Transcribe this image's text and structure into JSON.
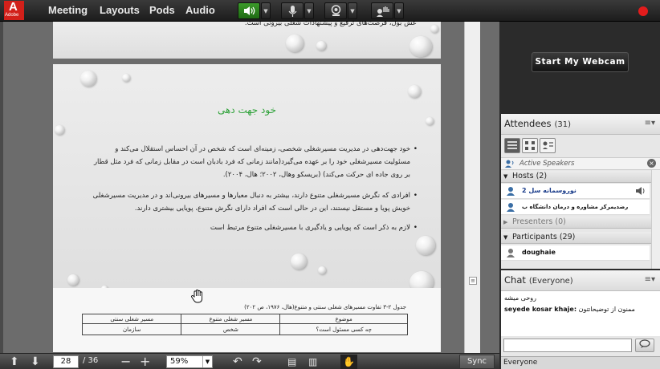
{
  "topbar": {
    "logo_text": "A",
    "logo_word": "Adobe",
    "menus": [
      "Meeting",
      "Layouts",
      "Pods",
      "Audio"
    ],
    "icons": [
      "speaker-icon",
      "microphone-icon",
      "webcam-icon",
      "raise-hand-icon"
    ],
    "speaker_color": "#2e8b22",
    "record_color": "#e21c1c"
  },
  "slides": {
    "prev_caption": "عش بول، فرصت‌های ترفیع و پیشنهادات شغلی بیرونی است.",
    "title": "خود جهت دهی",
    "title_color": "#2fa23a",
    "bullets": [
      "خود جهت‌دهی در مدیریت مسیرشغلی شخصی، زمینه‌ای است که شخص در آن احساس استقلال می‌کند و مسئولیت مسیرشغلی خود را بر عهده می‌گیرد(مانند زمانی که فرد بادبان است در مقابل زمانی که فرد مثل قطار بر روی جاده ای حرکت می‌کند) (بریسکو وهال، ۲۰۰۲؛ هال، ۲۰۰۴).",
      "افرادی که نگرش مسیرشغلی متنوع دارند، بیشتر به دنبال معیارها و مسیرهای بیرونی‌اند و در مدیریت مسیرشغلی خویش پویا و مستقل نیستند، این در حالی است که افراد دارای نگرش متنوع، پویایی بیشتری دارند.",
      "لازم به ذکر است که پویایی و یادگیری با مسیرشغلی متنوع مرتبط است"
    ],
    "table_caption": "جدول ۲-۳ تفاوت مسیرهای شغلی سنتی و متنوع(هال، ۱۹۷۶، ص ۲۰۲)",
    "table_headers": [
      "مسیر شغلی سنتی",
      "مسیر شغلی متنوع",
      "موضوع"
    ],
    "table_row": [
      "سازمان",
      "شخص",
      "چه کسی مسئول است؟"
    ]
  },
  "navbar": {
    "page": "28",
    "total": "/ 36",
    "zoom": "59%",
    "sync_label": "Sync"
  },
  "webcam": {
    "button_label": "Start My Webcam"
  },
  "attendees": {
    "title": "Attendees",
    "count": "(31)",
    "active_speakers": "Active Speakers",
    "hosts_label": "Hosts (2)",
    "hosts": [
      "2 نوروسمانه سل",
      "رضدیمرکز مشاوره و درمان دانشگاه ب"
    ],
    "presenters_label": "Presenters (0)",
    "participants_label": "Participants (29)",
    "participants": [
      "doughaie"
    ]
  },
  "chat": {
    "title": "Chat",
    "scope": "(Everyone)",
    "messages": [
      {
        "sender": "",
        "text": "روحی میشه"
      },
      {
        "sender": "seyede kosar khaje:",
        "text": "ممنون از توضیحاتتون"
      }
    ],
    "footer": "Everyone"
  }
}
